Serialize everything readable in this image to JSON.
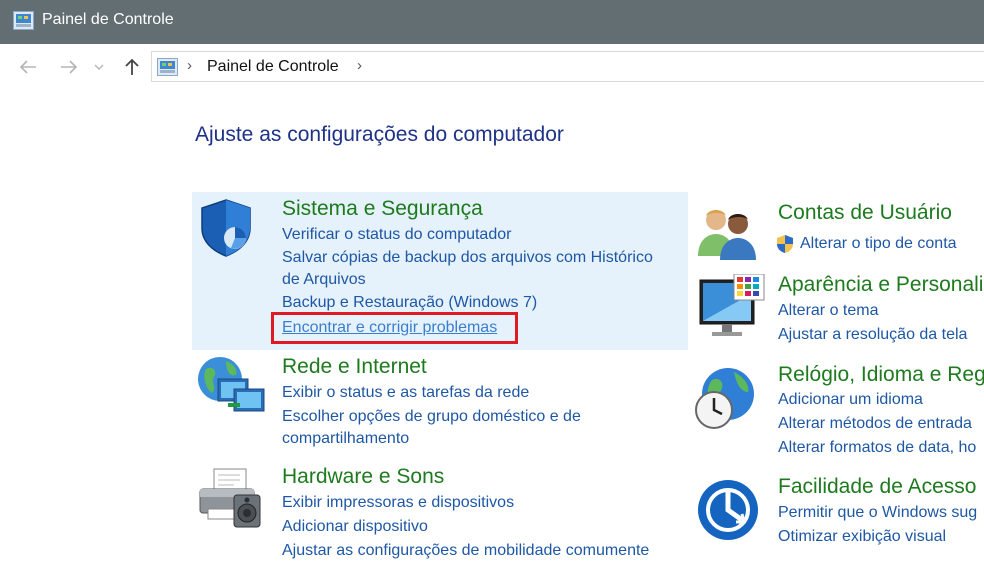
{
  "window": {
    "title": "Painel de Controle"
  },
  "address": {
    "crumb": "Painel de Controle",
    "sep1": "›",
    "sep2": "›"
  },
  "heading": "Ajuste as configurações do computador",
  "categories": [
    {
      "title": "Sistema e Segurança",
      "links": [
        "Verificar o status do computador",
        "Salvar cópias de backup dos arquivos com Histórico",
        "de Arquivos",
        "Backup e Restauração (Windows 7)",
        "Encontrar e corrigir problemas"
      ]
    },
    {
      "title": "Rede e Internet",
      "links": [
        "Exibir o status e as tarefas da rede",
        "Escolher opções de grupo doméstico e de",
        "compartilhamento"
      ]
    },
    {
      "title": "Hardware e Sons",
      "links": [
        "Exibir impressoras e dispositivos",
        "Adicionar dispositivo",
        "Ajustar as configurações de mobilidade comumente"
      ]
    },
    {
      "title": "Contas de Usuário",
      "links": [
        "Alterar o tipo de conta"
      ]
    },
    {
      "title": "Aparência e Personali",
      "links": [
        "Alterar o tema",
        "Ajustar a resolução da tela"
      ]
    },
    {
      "title": "Relógio, Idioma e Reg",
      "links": [
        "Adicionar um idioma",
        "Alterar métodos de entrada",
        "Alterar formatos de data, ho"
      ]
    },
    {
      "title": "Facilidade de Acesso",
      "links": [
        "Permitir que o Windows sug",
        "Otimizar exibição visual"
      ]
    }
  ],
  "colors": {
    "titlebar": "#636e72",
    "heading": "#1e3287",
    "category_title": "#1e7a1e",
    "link": "#1e57a5",
    "highlight": "#e01a22",
    "hover_bg": "#e5f1fb"
  },
  "icons": [
    "control-panel-icon",
    "back-arrow-icon",
    "forward-arrow-icon",
    "chevron-down-icon",
    "up-arrow-icon",
    "shield-icon",
    "globe-monitors-icon",
    "printer-icon",
    "users-icon",
    "monitor-palette-icon",
    "globe-clock-icon",
    "ease-of-access-icon",
    "uac-shield-icon"
  ]
}
